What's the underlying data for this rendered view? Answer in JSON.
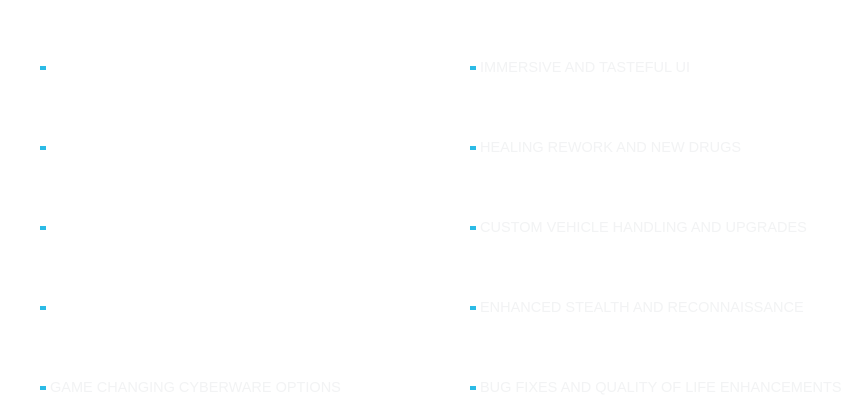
{
  "features": {
    "left": [
      {
        "label": ""
      },
      {
        "label": ""
      },
      {
        "label": ""
      },
      {
        "label": ""
      },
      {
        "label": "GAME CHANGING CYBERWARE OPTIONS"
      }
    ],
    "right": [
      {
        "label": "IMMERSIVE AND TASTEFUL UI"
      },
      {
        "label": "HEALING REWORK AND NEW DRUGS"
      },
      {
        "label": "CUSTOM VEHICLE HANDLING AND UPGRADES"
      },
      {
        "label": "ENHANCED STEALTH AND RECONNAISSANCE"
      },
      {
        "label": "BUG FIXES AND QUALITY OF LIFE ENHANCEMENTS"
      }
    ]
  },
  "colors": {
    "bullet": "#2bbbe6",
    "text": "#f2f3f4",
    "background": "#ffffff"
  },
  "icons": {
    "bullet": "square-bullet-icon"
  }
}
